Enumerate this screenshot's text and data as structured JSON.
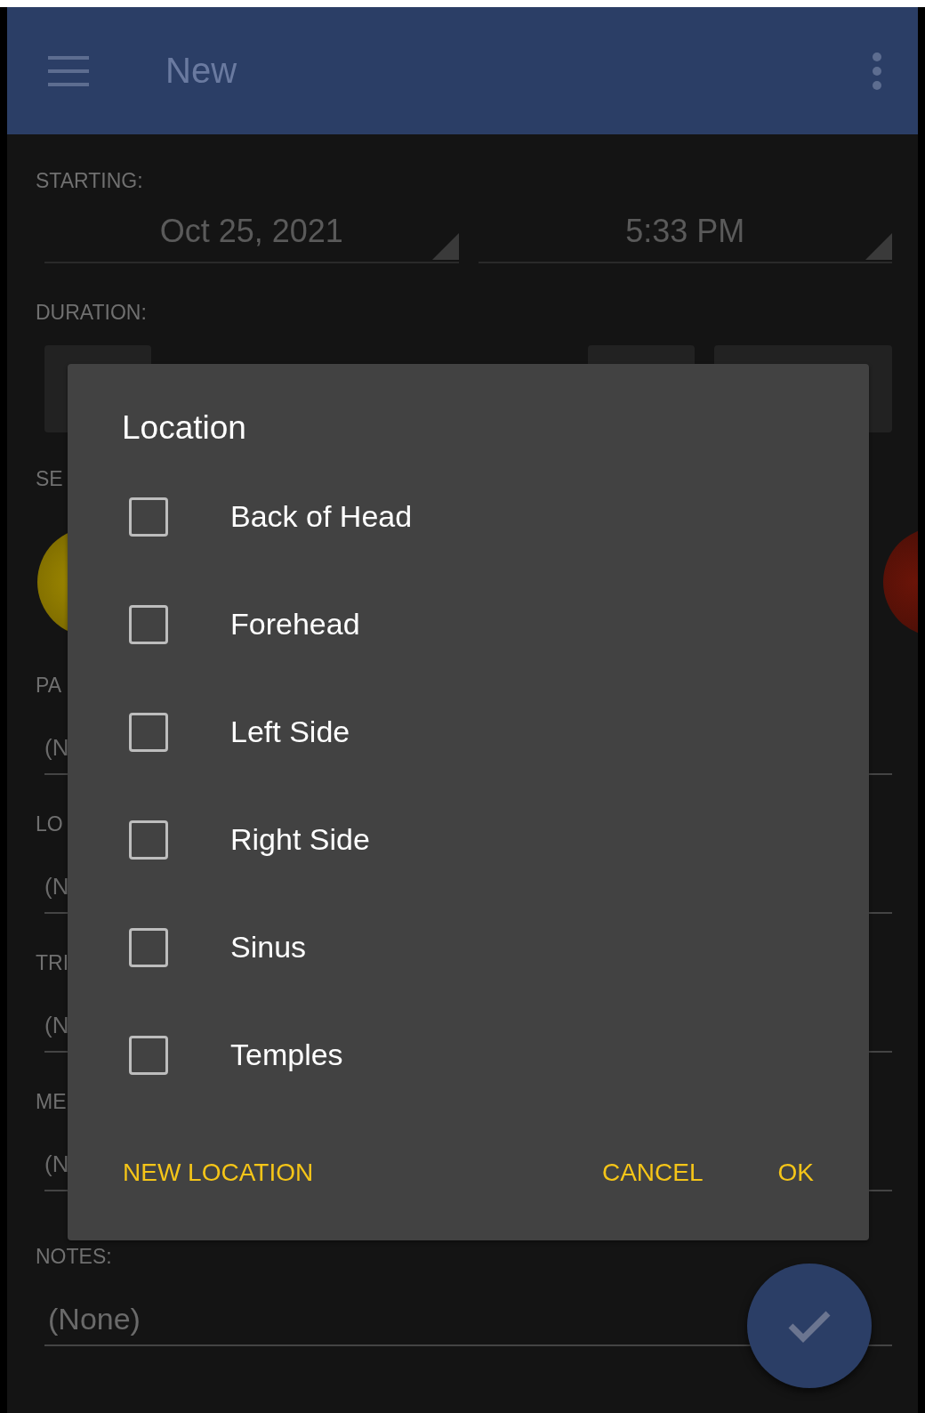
{
  "app_bar": {
    "title": "New"
  },
  "form": {
    "starting_label": "STARTING:",
    "date": "Oct 25, 2021",
    "time": "5:33 PM",
    "duration_label": "DURATION:",
    "severity_label": "SE",
    "fields": [
      {
        "label": "PA",
        "value": "(N"
      },
      {
        "label": "LO",
        "value": "(N"
      },
      {
        "label": "TRI",
        "value": "(N"
      },
      {
        "label": "ME",
        "value": "(N"
      }
    ],
    "notes_label": "NOTES:",
    "notes_value": "(None)"
  },
  "dialog": {
    "title": "Location",
    "options": [
      {
        "label": "Back of Head",
        "checked": false
      },
      {
        "label": "Forehead",
        "checked": false
      },
      {
        "label": "Left Side",
        "checked": false
      },
      {
        "label": "Right Side",
        "checked": false
      },
      {
        "label": "Sinus",
        "checked": false
      },
      {
        "label": "Temples",
        "checked": false
      }
    ],
    "buttons": [
      {
        "label": "NEW LOCATION"
      },
      {
        "label": "CANCEL"
      },
      {
        "label": "OK"
      }
    ]
  }
}
